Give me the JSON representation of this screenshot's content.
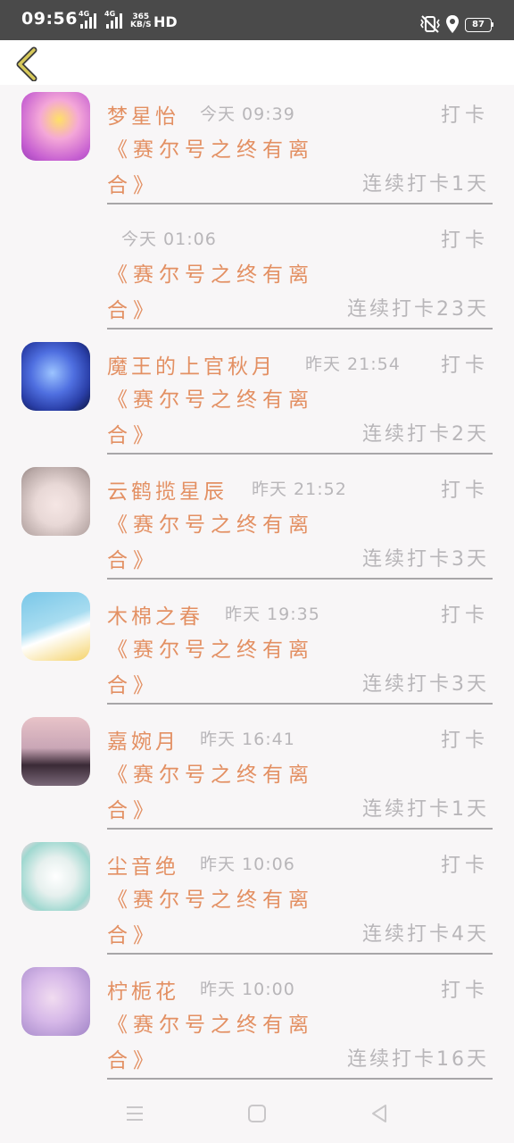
{
  "status_bar": {
    "time": "09:56",
    "sim1": "4G",
    "sim2": "4G",
    "speed_value": "365",
    "speed_unit": "KB/S",
    "hd": "HD",
    "battery": "87"
  },
  "header": {
    "back_icon": "back-chevron-icon"
  },
  "entries": [
    {
      "name": "梦星怡",
      "time": "今天 09:39",
      "action": "打卡",
      "book_line1": "《赛尔号之终有离",
      "book_line2": "合》",
      "streak": "连续打卡1天",
      "avatar_colors": [
        "#f4a7d8",
        "#c65fd1",
        "#ffe066"
      ]
    },
    {
      "name": "",
      "time": "今天 01:06",
      "action": "打卡",
      "book_line1": "《赛尔号之终有离",
      "book_line2": "合》",
      "streak": "连续打卡23天",
      "avatar_colors": []
    },
    {
      "name": "魔王的上官秋月",
      "time": "昨天 21:54",
      "action": "打卡",
      "book_line1": "《赛尔号之终有离",
      "book_line2": "合》",
      "streak": "连续打卡2天",
      "avatar_colors": [
        "#2a3fa8",
        "#6fa0ff",
        "#0b1440"
      ]
    },
    {
      "name": "云鹤揽星辰",
      "time": "昨天 21:52",
      "action": "打卡",
      "book_line1": "《赛尔号之终有离",
      "book_line2": "合》",
      "streak": "连续打卡3天",
      "avatar_colors": [
        "#e8e0e0",
        "#a89a98",
        "#f0c8c8"
      ]
    },
    {
      "name": "木棉之春",
      "time": "昨天 19:35",
      "action": "打卡",
      "book_line1": "《赛尔号之终有离",
      "book_line2": "合》",
      "streak": "连续打卡3天",
      "avatar_colors": [
        "#7ac7e8",
        "#f5d36b",
        "#ffffff"
      ]
    },
    {
      "name": "嘉婉月",
      "time": "昨天 16:41",
      "action": "打卡",
      "book_line1": "《赛尔号之终有离",
      "book_line2": "合》",
      "streak": "连续打卡1天",
      "avatar_colors": [
        "#c9a6b6",
        "#3a2a36",
        "#e8c3c8"
      ]
    },
    {
      "name": "尘音绝",
      "time": "昨天 10:06",
      "action": "打卡",
      "book_line1": "《赛尔号之终有离",
      "book_line2": "合》",
      "streak": "连续打卡4天",
      "avatar_colors": [
        "#e6f0ee",
        "#9fd8d0",
        "#f7d6e0"
      ]
    },
    {
      "name": "柠栀花",
      "time": "昨天 10:00",
      "action": "打卡",
      "book_line1": "《赛尔号之终有离",
      "book_line2": "合》",
      "streak": "连续打卡16天",
      "avatar_colors": [
        "#d6b8e8",
        "#a184c7",
        "#f1dcf0"
      ]
    }
  ],
  "nav": {
    "menu_icon": "menu-icon",
    "home_icon": "home-square-icon",
    "back_icon": "back-triangle-icon"
  },
  "colors": {
    "accent": "#e39063",
    "muted": "#b8b6b9",
    "divider": "#a8a6a8",
    "back_chevron": "#c8b84a"
  }
}
